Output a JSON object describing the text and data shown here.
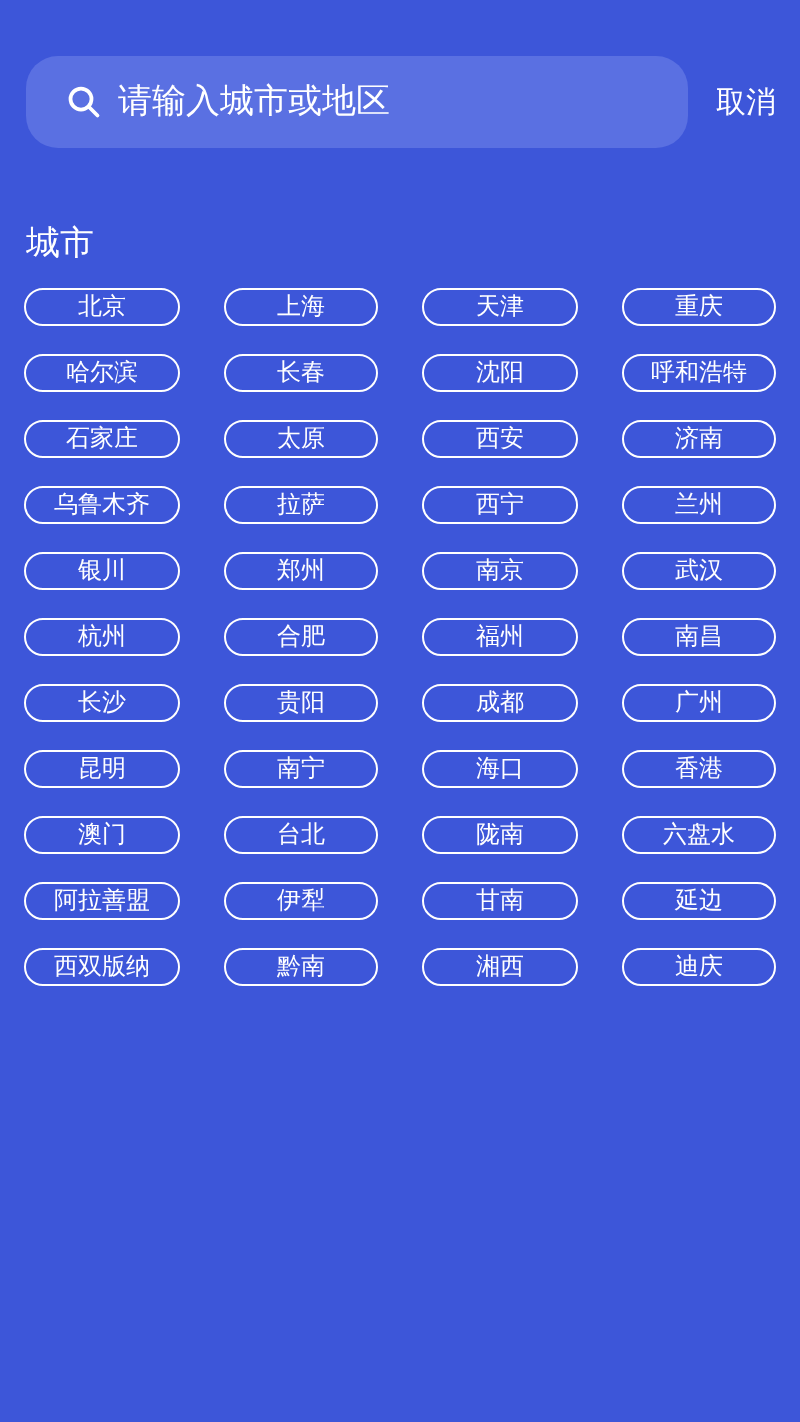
{
  "search": {
    "placeholder": "请输入城市或地区"
  },
  "cancel": "取消",
  "section_title": "城市",
  "cities": [
    "北京",
    "上海",
    "天津",
    "重庆",
    "哈尔滨",
    "长春",
    "沈阳",
    "呼和浩特",
    "石家庄",
    "太原",
    "西安",
    "济南",
    "乌鲁木齐",
    "拉萨",
    "西宁",
    "兰州",
    "银川",
    "郑州",
    "南京",
    "武汉",
    "杭州",
    "合肥",
    "福州",
    "南昌",
    "长沙",
    "贵阳",
    "成都",
    "广州",
    "昆明",
    "南宁",
    "海口",
    "香港",
    "澳门",
    "台北",
    "陇南",
    "六盘水",
    "阿拉善盟",
    "伊犁",
    "甘南",
    "延边",
    "西双版纳",
    "黔南",
    "湘西",
    "迪庆"
  ]
}
